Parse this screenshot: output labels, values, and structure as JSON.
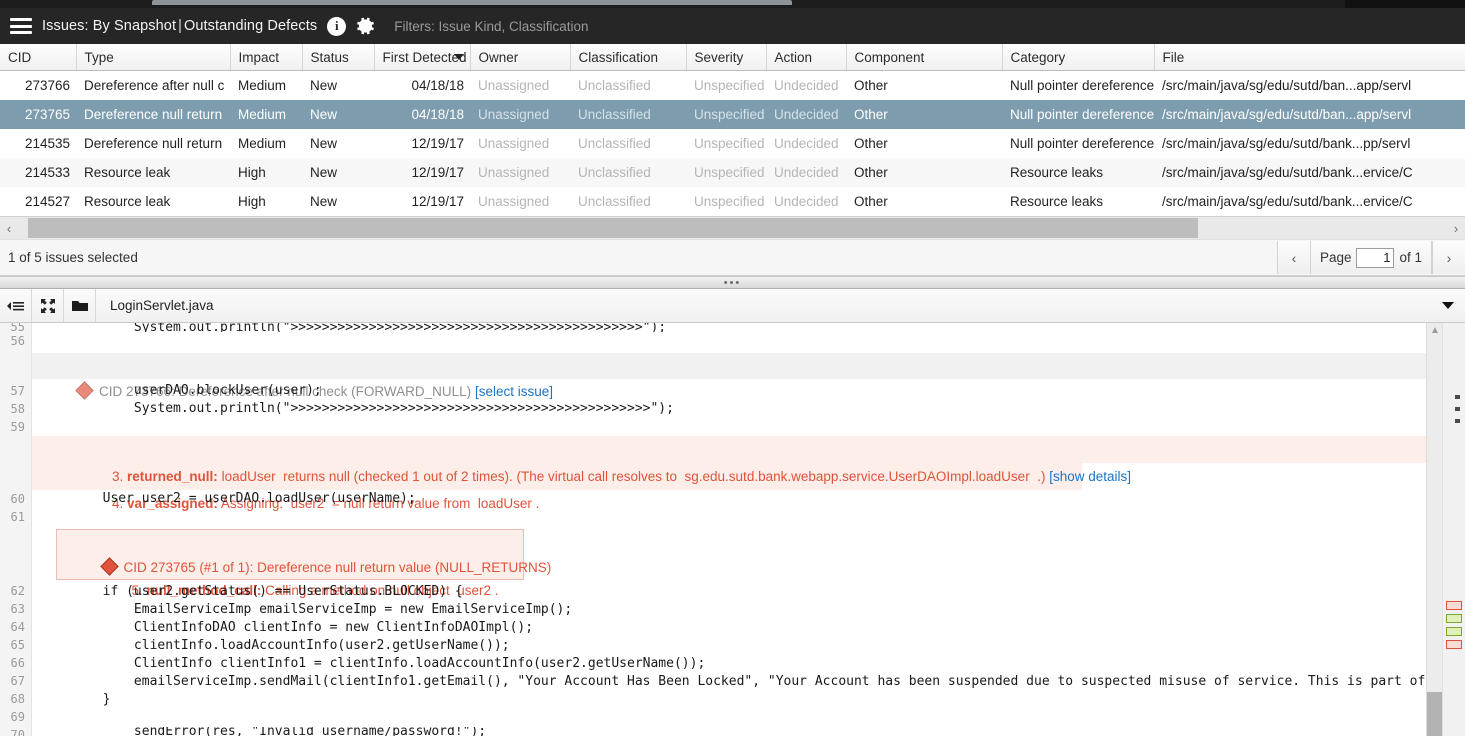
{
  "header": {
    "menu_icon": "hamburger-icon",
    "title_main": "Issues: By Snapshot",
    "title_sep": "|",
    "title_sub": "Outstanding Defects",
    "info_icon_label": "i",
    "settings_icon": "gear-icon",
    "filters": "Filters: Issue Kind, Classification"
  },
  "table": {
    "columns": [
      {
        "key": "cid",
        "label": "CID",
        "sorted": false
      },
      {
        "key": "type",
        "label": "Type",
        "sorted": false
      },
      {
        "key": "impact",
        "label": "Impact",
        "sorted": false
      },
      {
        "key": "status",
        "label": "Status",
        "sorted": false
      },
      {
        "key": "first_detected",
        "label": "First Detected",
        "sorted": true
      },
      {
        "key": "owner",
        "label": "Owner",
        "sorted": false
      },
      {
        "key": "classification",
        "label": "Classification",
        "sorted": false
      },
      {
        "key": "severity",
        "label": "Severity",
        "sorted": false
      },
      {
        "key": "action",
        "label": "Action",
        "sorted": false
      },
      {
        "key": "component",
        "label": "Component",
        "sorted": false
      },
      {
        "key": "category",
        "label": "Category",
        "sorted": false
      },
      {
        "key": "file",
        "label": "File",
        "sorted": false
      }
    ],
    "rows": [
      {
        "cid": "273766",
        "type": "Dereference after null c",
        "impact": "Medium",
        "status": "New",
        "first_detected": "04/18/18",
        "owner": "Unassigned",
        "classification": "Unclassified",
        "severity": "Unspecified",
        "action": "Undecided",
        "component": "Other",
        "category": "Null pointer dereference",
        "file": "/src/main/java/sg/edu/sutd/ban...app/servl",
        "selected": false
      },
      {
        "cid": "273765",
        "type": "Dereference null return",
        "impact": "Medium",
        "status": "New",
        "first_detected": "04/18/18",
        "owner": "Unassigned",
        "classification": "Unclassified",
        "severity": "Unspecified",
        "action": "Undecided",
        "component": "Other",
        "category": "Null pointer dereference",
        "file": "/src/main/java/sg/edu/sutd/ban...app/servl",
        "selected": true
      },
      {
        "cid": "214535",
        "type": "Dereference null return",
        "impact": "Medium",
        "status": "New",
        "first_detected": "12/19/17",
        "owner": "Unassigned",
        "classification": "Unclassified",
        "severity": "Unspecified",
        "action": "Undecided",
        "component": "Other",
        "category": "Null pointer dereference",
        "file": "/src/main/java/sg/edu/sutd/bank...pp/servl",
        "selected": false
      },
      {
        "cid": "214533",
        "type": "Resource leak",
        "impact": "High",
        "status": "New",
        "first_detected": "12/19/17",
        "owner": "Unassigned",
        "classification": "Unclassified",
        "severity": "Unspecified",
        "action": "Undecided",
        "component": "Other",
        "category": "Resource leaks",
        "file": "/src/main/java/sg/edu/sutd/bank...ervice/C",
        "selected": false
      },
      {
        "cid": "214527",
        "type": "Resource leak",
        "impact": "High",
        "status": "New",
        "first_detected": "12/19/17",
        "owner": "Unassigned",
        "classification": "Unclassified",
        "severity": "Unspecified",
        "action": "Undecided",
        "component": "Other",
        "category": "Resource leaks",
        "file": "/src/main/java/sg/edu/sutd/bank...ervice/C",
        "selected": false
      }
    ]
  },
  "statusbar": {
    "selection_text": "1 of 5 issues selected",
    "prev_page_icon": "chevron-left-icon",
    "next_page_icon": "chevron-right-icon",
    "page_label": "Page",
    "page_value": "1",
    "page_of": "of 1"
  },
  "editor": {
    "toolbar": {
      "outline_icon": "outline-list-icon",
      "expand_icon": "expand-icon",
      "folder_icon": "folder-icon",
      "filename": "LoginServlet.java",
      "dropdown_icon": "chevron-down-icon"
    },
    "lines": [
      {
        "n": "55",
        "kind": "code",
        "clipped": true,
        "text": "            System.out.println(\">>>>>>>>>>>>>>>>>>>>>>>>>>>>>>>>>>>>>>>>>>>>>\");"
      },
      {
        "n": "56",
        "kind": "code",
        "text": ""
      },
      {
        "kind": "event-grey",
        "cid": "CID 273766: Dereference after null check (FORWARD_NULL)",
        "link": "[select issue]"
      },
      {
        "n": "57",
        "kind": "code",
        "text": "            userDAO.blockUser(user);"
      },
      {
        "n": "58",
        "kind": "code",
        "text": "            System.out.println(\">>>>>>>>>>>>>>>>>>>>>>>>>>>>>>>>>>>>>>>>>>>>>>\");"
      },
      {
        "n": "59",
        "kind": "code",
        "text": ""
      },
      {
        "kind": "event-red",
        "num": "3.",
        "tag": "returned_null:",
        "body": "loadUser  returns null (checked 1 out of 2 times). (The virtual call resolves to  sg.edu.sutd.bank.webapp.service.UserDAOImpl.loadUser  .)",
        "link": "[show details]"
      },
      {
        "kind": "event-red",
        "num": "4.",
        "tag": "var_assigned:",
        "body": "Assigning:  user2  = null return value from  loadUser ."
      },
      {
        "n": "60",
        "kind": "code",
        "text": "        User user2 = userDAO.loadUser(userName);"
      },
      {
        "n": "61",
        "kind": "code",
        "text": ""
      },
      {
        "kind": "event-block",
        "title": "CID 273765 (#1 of 1): Dereference null return value (NULL_RETURNS)",
        "num": "5.",
        "tag": "null_method_call:",
        "body": "Calling a method on null object  user2 ."
      },
      {
        "n": "62",
        "kind": "code",
        "text": "        if (user2.getStatus() == UserStatus.BLOCKED) {"
      },
      {
        "n": "63",
        "kind": "code",
        "text": "            EmailServiceImp emailServiceImp = new EmailServiceImp();"
      },
      {
        "n": "64",
        "kind": "code",
        "text": "            ClientInfoDAO clientInfo = new ClientInfoDAOImpl();"
      },
      {
        "n": "65",
        "kind": "code",
        "text": "            clientInfo.loadAccountInfo(user2.getUserName());"
      },
      {
        "n": "66",
        "kind": "code",
        "text": "            ClientInfo clientInfo1 = clientInfo.loadAccountInfo(user2.getUserName());"
      },
      {
        "n": "67",
        "kind": "code",
        "text": "            emailServiceImp.sendMail(clientInfo1.getEmail(), \"Your Account Has Been Locked\", \"Your Account has been suspended due to suspected misuse of service. This is part of Di"
      },
      {
        "n": "68",
        "kind": "code",
        "text": "        }"
      },
      {
        "n": "69",
        "kind": "code",
        "text": ""
      },
      {
        "n": "70",
        "kind": "code",
        "clipped": true,
        "text": "            sendError(res, \"Invalid username/password!\");"
      }
    ],
    "margin_markers": [
      {
        "color": "red"
      },
      {
        "color": "green"
      },
      {
        "color": "green"
      },
      {
        "color": "red"
      }
    ]
  },
  "colors": {
    "header_bg": "#262626",
    "selected_row": "#7d9cad",
    "issue_red": "#e0533a",
    "link_blue": "#1a73c9",
    "string_blue": "#3a3ad0"
  }
}
